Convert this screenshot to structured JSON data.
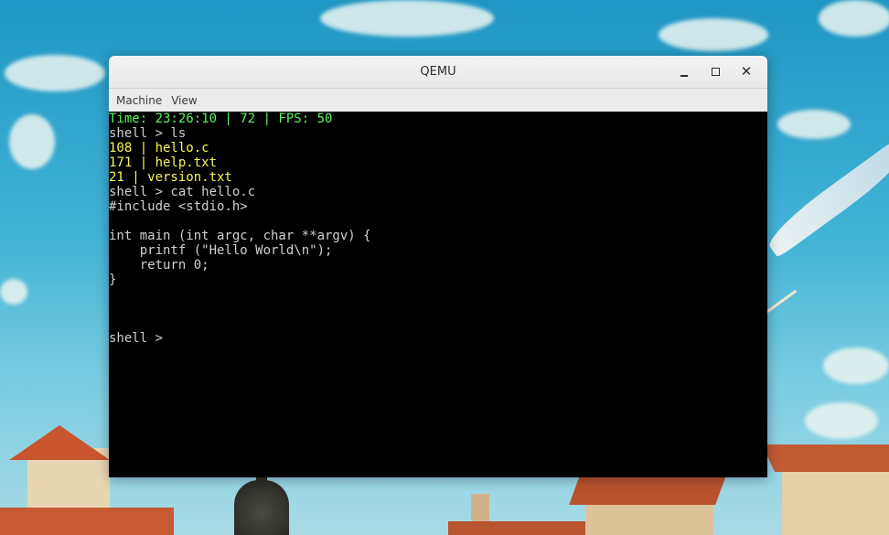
{
  "window": {
    "title": "QEMU",
    "close_glyph": "✕"
  },
  "menubar": {
    "items": [
      "Machine",
      "View"
    ]
  },
  "terminal": {
    "lines": [
      {
        "text": "Time: 23:26:10 | 72 | FPS: 50",
        "kind": "status"
      },
      {
        "text": "shell > ls",
        "kind": "shell"
      },
      {
        "text": "108 | hello.c",
        "kind": "file"
      },
      {
        "text": "171 | help.txt",
        "kind": "file"
      },
      {
        "text": "21 | version.txt",
        "kind": "file"
      },
      {
        "text": "shell > cat hello.c",
        "kind": "shell"
      },
      {
        "text": "#include <stdio.h>",
        "kind": "shell"
      },
      {
        "text": "",
        "kind": "shell"
      },
      {
        "text": "int main (int argc, char **argv) {",
        "kind": "shell"
      },
      {
        "text": "    printf (\"Hello World\\n\");",
        "kind": "shell"
      },
      {
        "text": "    return 0;",
        "kind": "shell"
      },
      {
        "text": "}",
        "kind": "shell"
      },
      {
        "text": "",
        "kind": "shell"
      },
      {
        "text": "",
        "kind": "shell"
      },
      {
        "text": "",
        "kind": "shell"
      },
      {
        "text": "shell > ",
        "kind": "shell"
      }
    ]
  },
  "colors": {
    "status_text": "#5cf55c",
    "file_text": "#f7f75a",
    "shell_text": "#d0d0d0",
    "terminal_bg": "#000000"
  }
}
